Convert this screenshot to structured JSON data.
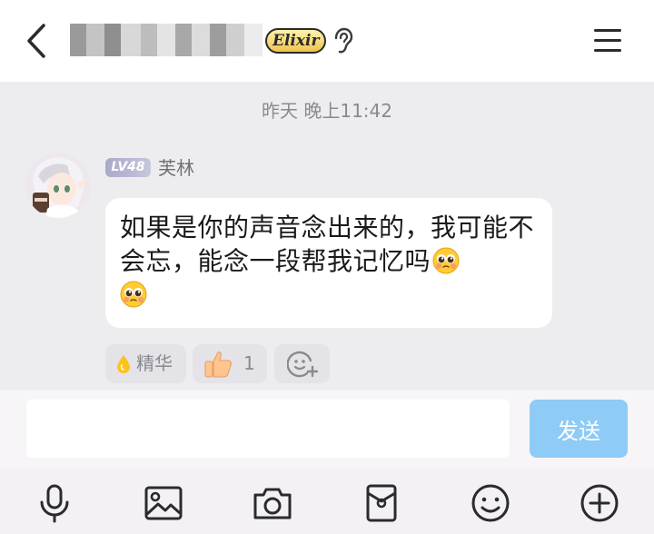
{
  "header": {
    "contact_name_blurred": "",
    "member_badge": "Elixir"
  },
  "chat": {
    "timestamp": "昨天 晚上11:42",
    "message": {
      "level_badge": "LV48",
      "sender": "芙林",
      "text": "如果是你的声音念出来的，我可能不会忘，能念一段帮我记忆吗",
      "emojis": [
        "pleading-face",
        "pleading-face"
      ],
      "reactions": {
        "featured_label": "精华",
        "like_count": "1"
      }
    }
  },
  "composer": {
    "input_value": "",
    "input_placeholder": "",
    "send_label": "发送"
  },
  "toolbar": {
    "items": [
      "microphone-icon",
      "image-icon",
      "camera-icon",
      "red-packet-icon",
      "emoji-icon",
      "add-icon"
    ]
  },
  "colors": {
    "send_button": "#8ecbf6",
    "chat_background": "#ededf0",
    "bubble": "#ffffff",
    "level_badge": "#b4b4d2"
  }
}
